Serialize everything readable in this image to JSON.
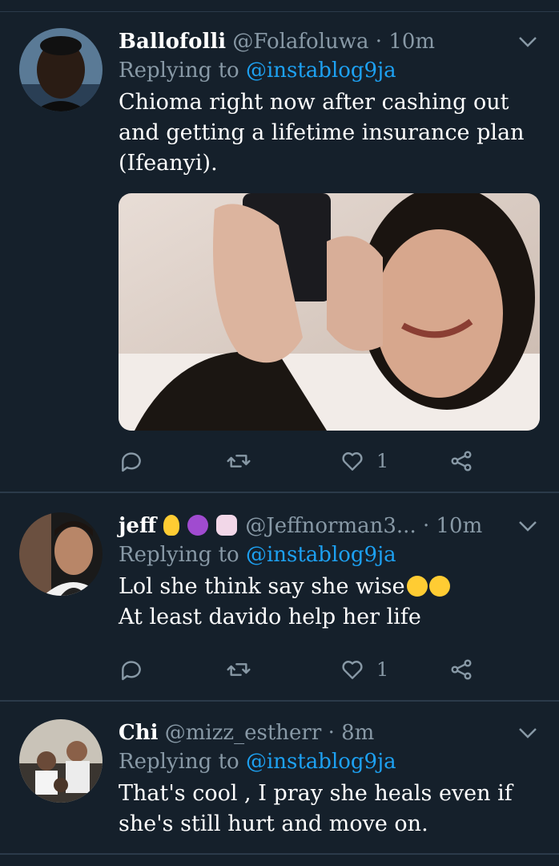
{
  "tweets": [
    {
      "name": "Ballofolli",
      "handle": "@Folafoluwa",
      "time": "· 10m",
      "replying_prefix": "Replying to",
      "replying_handle": "@instablog9ja",
      "text_lines": [
        "Chioma right now after cashing out",
        "and getting a lifetime insurance plan",
        "(Ifeanyi)."
      ],
      "has_media": true,
      "reply_count": "",
      "retweet_count": "",
      "like_count": "1"
    },
    {
      "name": "jeff",
      "name_emojis": [
        "lightbulb-emoji",
        "devil-emoji",
        "unicorn-emoji"
      ],
      "handle": "@Jeffnorman3...",
      "time": "· 10m",
      "replying_prefix": "Replying to",
      "replying_handle": "@instablog9ja",
      "text_lines": [
        "Lol she think say she wise",
        "At least davido help her life"
      ],
      "text_emojis": [
        "laughing-tears-emoji",
        "laughing-tears-emoji"
      ],
      "has_media": false,
      "reply_count": "",
      "retweet_count": "",
      "like_count": "1"
    },
    {
      "name": "Chi",
      "handle": "@mizz_estherr",
      "time": "· 8m",
      "replying_prefix": "Replying to",
      "replying_handle": "@instablog9ja",
      "text_lines": [
        "That's cool , I pray she heals even if",
        "she's still hurt and move on."
      ],
      "has_media": false
    }
  ],
  "colors": {
    "background": "#15202b",
    "secondary_text": "#8899a6",
    "link": "#1da1f2",
    "divider": "#2b3a4a"
  }
}
